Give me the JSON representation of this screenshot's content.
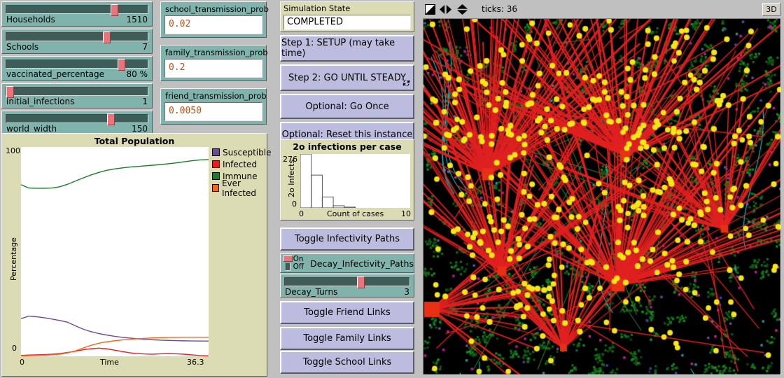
{
  "sliders": [
    {
      "name": "Households",
      "value": "1510",
      "pos": 0.74
    },
    {
      "name": "Schools",
      "value": "7",
      "pos": 0.685
    },
    {
      "name": "vaccinated_percentage",
      "value": "80 %",
      "pos": 0.785
    },
    {
      "name": "initial_infections",
      "value": "1",
      "pos": 0.003
    },
    {
      "name": "world_width",
      "value": "150",
      "pos": 0.715
    }
  ],
  "inputs": [
    {
      "label": "school_transmission_prob",
      "value": "0.02"
    },
    {
      "label": "family_transmission_prob",
      "value": "0.2"
    },
    {
      "label": "friend_transmission_prob",
      "value": "0.0050"
    }
  ],
  "monitor": {
    "label": "Simulation State",
    "value": "COMPLETED"
  },
  "buttons": {
    "setup": "Step 1: SETUP (may take time)",
    "go_steady": "Step 2: GO UNTIL STEADY",
    "go_once": "Optional: Go Once",
    "reset": "Optional: Reset this instance",
    "toggle_infectivity": "Toggle  Infectivity Paths",
    "toggle_friend": "Toggle Friend Links",
    "toggle_family": "Toggle Family Links",
    "toggle_school": "Toggle School Links",
    "rerun_icon": "↻"
  },
  "switch": {
    "name": "Decay_Infectivity_Paths",
    "on_label": "On",
    "off_label": "Off",
    "state": "On"
  },
  "decay_slider": {
    "name": "Decay_Turns",
    "value": "3",
    "pos": 0.58
  },
  "world": {
    "ticks_label": "ticks: 36",
    "button_3d": "3D",
    "icons": [
      "resize-icon",
      "left-right-arrows-icon",
      "up-down-arrows-icon"
    ],
    "background": "#000000"
  },
  "chart_data": [
    {
      "type": "line",
      "title": "Total Population",
      "xlabel": "Time",
      "ylabel": "Percentage",
      "xlim": [
        0,
        36.3
      ],
      "ylim": [
        0,
        100
      ],
      "xticks": [
        "0",
        "36.3"
      ],
      "yticks": [
        "0",
        "100"
      ],
      "grid": false,
      "legend_position": "right",
      "legend": [
        {
          "name": "Susceptible",
          "color": "#6a4b96"
        },
        {
          "name": "Infected",
          "color": "#e02020"
        },
        {
          "name": "Immune",
          "color": "#1f7a2e"
        },
        {
          "name": "Ever Infected",
          "color": "#f26a1b"
        }
      ],
      "x": [
        0,
        1.5,
        3,
        4.5,
        6,
        7.5,
        9,
        10.5,
        12,
        13.5,
        15,
        16.5,
        18,
        19.5,
        21,
        22.5,
        24,
        25.5,
        27,
        28.5,
        30,
        31.5,
        33,
        34.5,
        36.3
      ],
      "series": [
        {
          "name": "Susceptible",
          "color": "#6a4b96",
          "values": [
            18.0,
            19.2,
            18.9,
            18.4,
            17.8,
            17.1,
            16.3,
            14.6,
            13.0,
            11.8,
            10.9,
            10.2,
            9.6,
            9.1,
            8.7,
            8.4,
            8.1,
            7.9,
            7.7,
            7.6,
            7.5,
            7.4,
            7.35,
            7.3,
            7.3
          ]
        },
        {
          "name": "Infected",
          "color": "#e02020",
          "values": [
            0.4,
            0.6,
            0.7,
            0.8,
            1.0,
            1.3,
            1.8,
            2.4,
            3.1,
            3.6,
            3.9,
            3.6,
            3.0,
            2.3,
            1.7,
            1.3,
            1.1,
            1.0,
            1.2,
            1.3,
            1.2,
            1.0,
            0.7,
            0.4,
            0.2
          ]
        },
        {
          "name": "Immune",
          "color": "#1f7a2e",
          "values": [
            82.0,
            80.4,
            80.3,
            80.3,
            80.4,
            81.0,
            82.2,
            83.7,
            85.2,
            86.6,
            87.8,
            88.8,
            89.5,
            90.0,
            90.4,
            90.7,
            91.0,
            91.3,
            91.6,
            92.0,
            92.4,
            92.9,
            93.4,
            93.8,
            94.0
          ]
        },
        {
          "name": "Ever Infected",
          "color": "#f26a1b",
          "values": [
            0.2,
            0.3,
            0.4,
            0.5,
            0.7,
            1.0,
            1.6,
            2.6,
            3.9,
            5.2,
            6.2,
            6.9,
            7.4,
            7.8,
            8.1,
            8.4,
            8.6,
            8.8,
            8.9,
            9.0,
            9.05,
            9.1,
            9.1,
            9.1,
            9.1
          ]
        }
      ]
    },
    {
      "type": "bar",
      "title": "2o infections per case",
      "xlabel": "Count of cases",
      "ylabel": "2o Infects",
      "xlim": [
        0,
        10
      ],
      "ylim": [
        0,
        276
      ],
      "xticks": [
        "0",
        "10"
      ],
      "yticks": [
        "0",
        "276"
      ],
      "grid": false,
      "categories": [
        "0",
        "1",
        "2",
        "3",
        "4"
      ],
      "values": [
        276,
        168,
        56,
        11,
        4
      ]
    }
  ]
}
